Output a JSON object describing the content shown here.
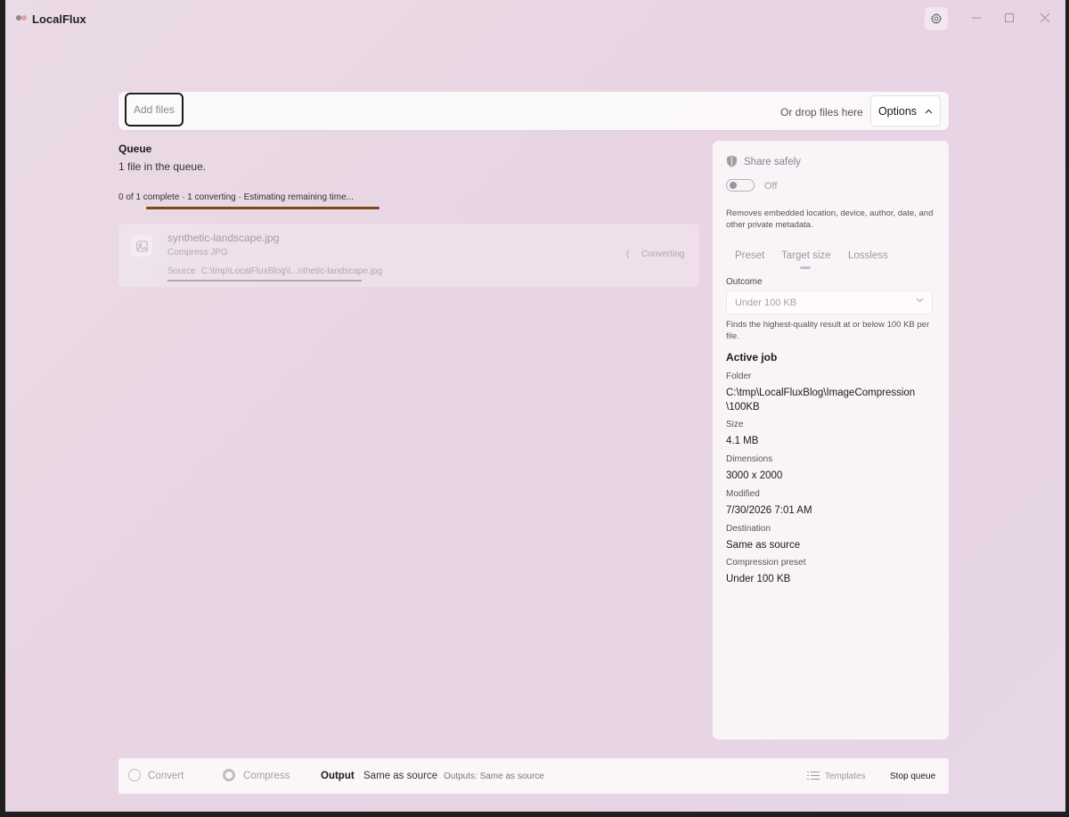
{
  "app": {
    "title": "LocalFlux"
  },
  "toolbar": {
    "add_files": "Add files",
    "drop_hint": "Or drop files here",
    "options": "Options"
  },
  "queue": {
    "title": "Queue",
    "count": "1 file in the queue.",
    "status": "0 of 1 complete · 1 converting · Estimating remaining time...",
    "items": [
      {
        "name": "synthetic-landscape.jpg",
        "operation": "Compress JPG",
        "source_label": "Source",
        "source_path": "C:\\tmp\\LocalFluxBlog\\I...nthetic-landscape.jpg",
        "state": "Converting",
        "spinner": "("
      }
    ]
  },
  "panel": {
    "share_title": "Share safely",
    "toggle_state": "Off",
    "privacy_desc": "Removes embedded location, device, author, date, and other private metadata.",
    "tabs": [
      "Preset",
      "Target size",
      "Lossless"
    ],
    "active_tab": "Target size",
    "outcome_label": "Outcome",
    "outcome_value": "Under 100 KB",
    "outcome_help": "Finds the highest-quality result at or below 100 KB per file.",
    "active_job_title": "Active job",
    "meta": [
      {
        "label": "Folder",
        "value": "C:\\tmp\\LocalFluxBlog\\ImageCompression\n\\100KB"
      },
      {
        "label": "Size",
        "value": "4.1 MB"
      },
      {
        "label": "Dimensions",
        "value": "3000 x 2000"
      },
      {
        "label": "Modified",
        "value": "7/30/2026 7:01 AM"
      },
      {
        "label": "Destination",
        "value": "Same as source"
      },
      {
        "label": "Compression preset",
        "value": "Under 100 KB"
      }
    ]
  },
  "bottom": {
    "convert": "Convert",
    "compress": "Compress",
    "output_label": "Output",
    "output_value": "Same as source",
    "outputs_summary": "Outputs: Same as source",
    "templates": "Templates",
    "stop_queue": "Stop queue"
  },
  "colors": {
    "accent_progress": "#7a4b14",
    "background": "#e8d4e3"
  },
  "icons": {
    "logo": "app-logo-icon",
    "settings": "gear-icon",
    "share": "shield-icon",
    "file": "image-icon",
    "templates": "list-icon"
  }
}
